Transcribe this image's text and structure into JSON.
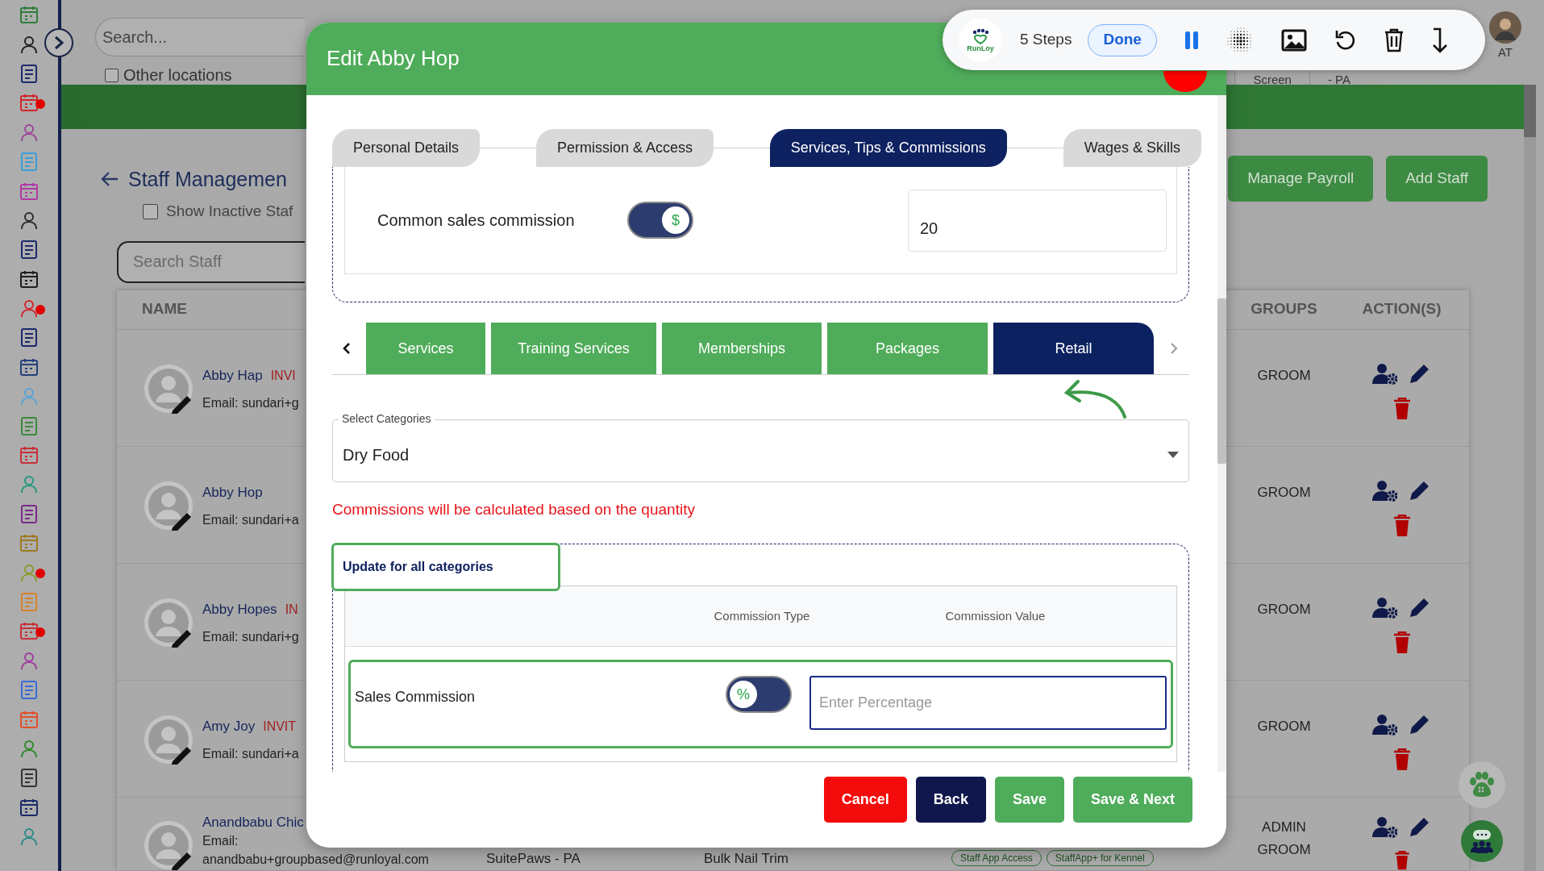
{
  "sidebar": {
    "items": [
      {
        "color": "#2f7d3a",
        "alert": false
      },
      {
        "color": "#1e1e1e",
        "alert": false
      },
      {
        "color": "#1b2a6b",
        "alert": false
      },
      {
        "color": "#d1262c",
        "alert": true
      },
      {
        "color": "#9c4597",
        "alert": false
      },
      {
        "color": "#3a9ed6",
        "alert": false
      },
      {
        "color": "#b03aa6",
        "alert": false
      },
      {
        "color": "#2a2a2a",
        "alert": false
      },
      {
        "color": "#1b2a6b",
        "alert": false
      },
      {
        "color": "#1e1e1e",
        "alert": false
      },
      {
        "color": "#d1262c",
        "alert": true
      },
      {
        "color": "#1b2a6b",
        "alert": false
      },
      {
        "color": "#24407a",
        "alert": false
      },
      {
        "color": "#5aa4d8",
        "alert": false
      },
      {
        "color": "#3c8a3c",
        "alert": false
      },
      {
        "color": "#c8303a",
        "alert": false
      },
      {
        "color": "#23997f",
        "alert": false
      },
      {
        "color": "#7a2a8a",
        "alert": false
      },
      {
        "color": "#9c7a20",
        "alert": false
      },
      {
        "color": "#8a9a2a",
        "alert": true
      },
      {
        "color": "#d8822a",
        "alert": false
      },
      {
        "color": "#c8303a",
        "alert": true
      },
      {
        "color": "#a03aa0",
        "alert": false
      },
      {
        "color": "#3a6ad8",
        "alert": false
      },
      {
        "color": "#e0502a",
        "alert": false
      },
      {
        "color": "#2a8a2a",
        "alert": false
      },
      {
        "color": "#333333",
        "alert": false
      },
      {
        "color": "#1b2a6b",
        "alert": false
      },
      {
        "color": "#2a8a8a",
        "alert": false
      }
    ]
  },
  "header": {
    "search_placeholder": "Search...",
    "other_locations": {
      "label": "Other locations",
      "checked": false
    },
    "right_texts": [
      "Screen",
      "- PA"
    ],
    "user_initials": "AT"
  },
  "page": {
    "title": "Staff Managemen",
    "show_inactive": {
      "label": "Show Inactive Staf",
      "checked": false
    },
    "search_placeholder": "Search Staff",
    "buttons": [
      "Manage Payroll",
      "Add Staff"
    ]
  },
  "table": {
    "columns": [
      "NAME",
      "GROUPS",
      "ACTION(S)"
    ],
    "rows": [
      {
        "name": "Abby Hap",
        "status": "INVI",
        "email": "Email: sundari+g",
        "groups": [
          "GROOM"
        ]
      },
      {
        "name": "Abby Hop",
        "email": "Email: sundari+a",
        "groups": [
          "GROOM"
        ]
      },
      {
        "name": "Abby Hopes",
        "status": "IN",
        "email": "Email: sundari+g",
        "groups": [
          "GROOM"
        ]
      },
      {
        "name": "Amy Joy",
        "status": "INVIT",
        "email": "Email: sundari+a",
        "groups": [
          "GROOM"
        ]
      },
      {
        "name": "Anandbabu Chic",
        "email_label": "Email:",
        "email": "anandbabu+groupbased@runloyal.com",
        "location": "SuitePaws - PA",
        "service": "Bulk Nail Trim",
        "access": [
          "Staff App Access",
          "StaffApp+ for Kennel"
        ],
        "groups": [
          "ADMIN",
          "GROOM"
        ]
      }
    ]
  },
  "modal": {
    "title": "Edit Abby Hop",
    "tabs": [
      {
        "label": "Personal Details",
        "selected": false
      },
      {
        "label": "Permission & Access",
        "selected": false
      },
      {
        "label": "Services, Tips & Commissions",
        "selected": true
      },
      {
        "label": "Wages & Skills",
        "selected": false
      }
    ],
    "common_commission": {
      "label": "Common sales commission",
      "on": true,
      "symbol": "$",
      "value": "20"
    },
    "category_tabs": [
      {
        "label": "Services",
        "selected": false
      },
      {
        "label": "Training Services",
        "selected": false
      },
      {
        "label": "Memberships",
        "selected": false
      },
      {
        "label": "Packages",
        "selected": false
      },
      {
        "label": "Retail",
        "selected": true
      }
    ],
    "select": {
      "label": "Select Categories",
      "value": "Dry Food"
    },
    "note": "Commissions will be calculated based on the quantity",
    "update_all": "Update for all categories",
    "commission_table": {
      "columns": [
        "Commission Type",
        "Commission Value"
      ],
      "rows": [
        {
          "name": "Sales Commission",
          "on": false,
          "symbol": "%",
          "placeholder": "Enter Percentage"
        }
      ]
    },
    "buttons": [
      {
        "label": "Cancel",
        "kind": "danger"
      },
      {
        "label": "Back",
        "kind": "dark"
      },
      {
        "label": "Save",
        "kind": "success"
      },
      {
        "label": "Save & Next",
        "kind": "success"
      }
    ]
  },
  "toolbar": {
    "logo_text": "RunLoy",
    "steps": "5 Steps",
    "done": "Done"
  }
}
